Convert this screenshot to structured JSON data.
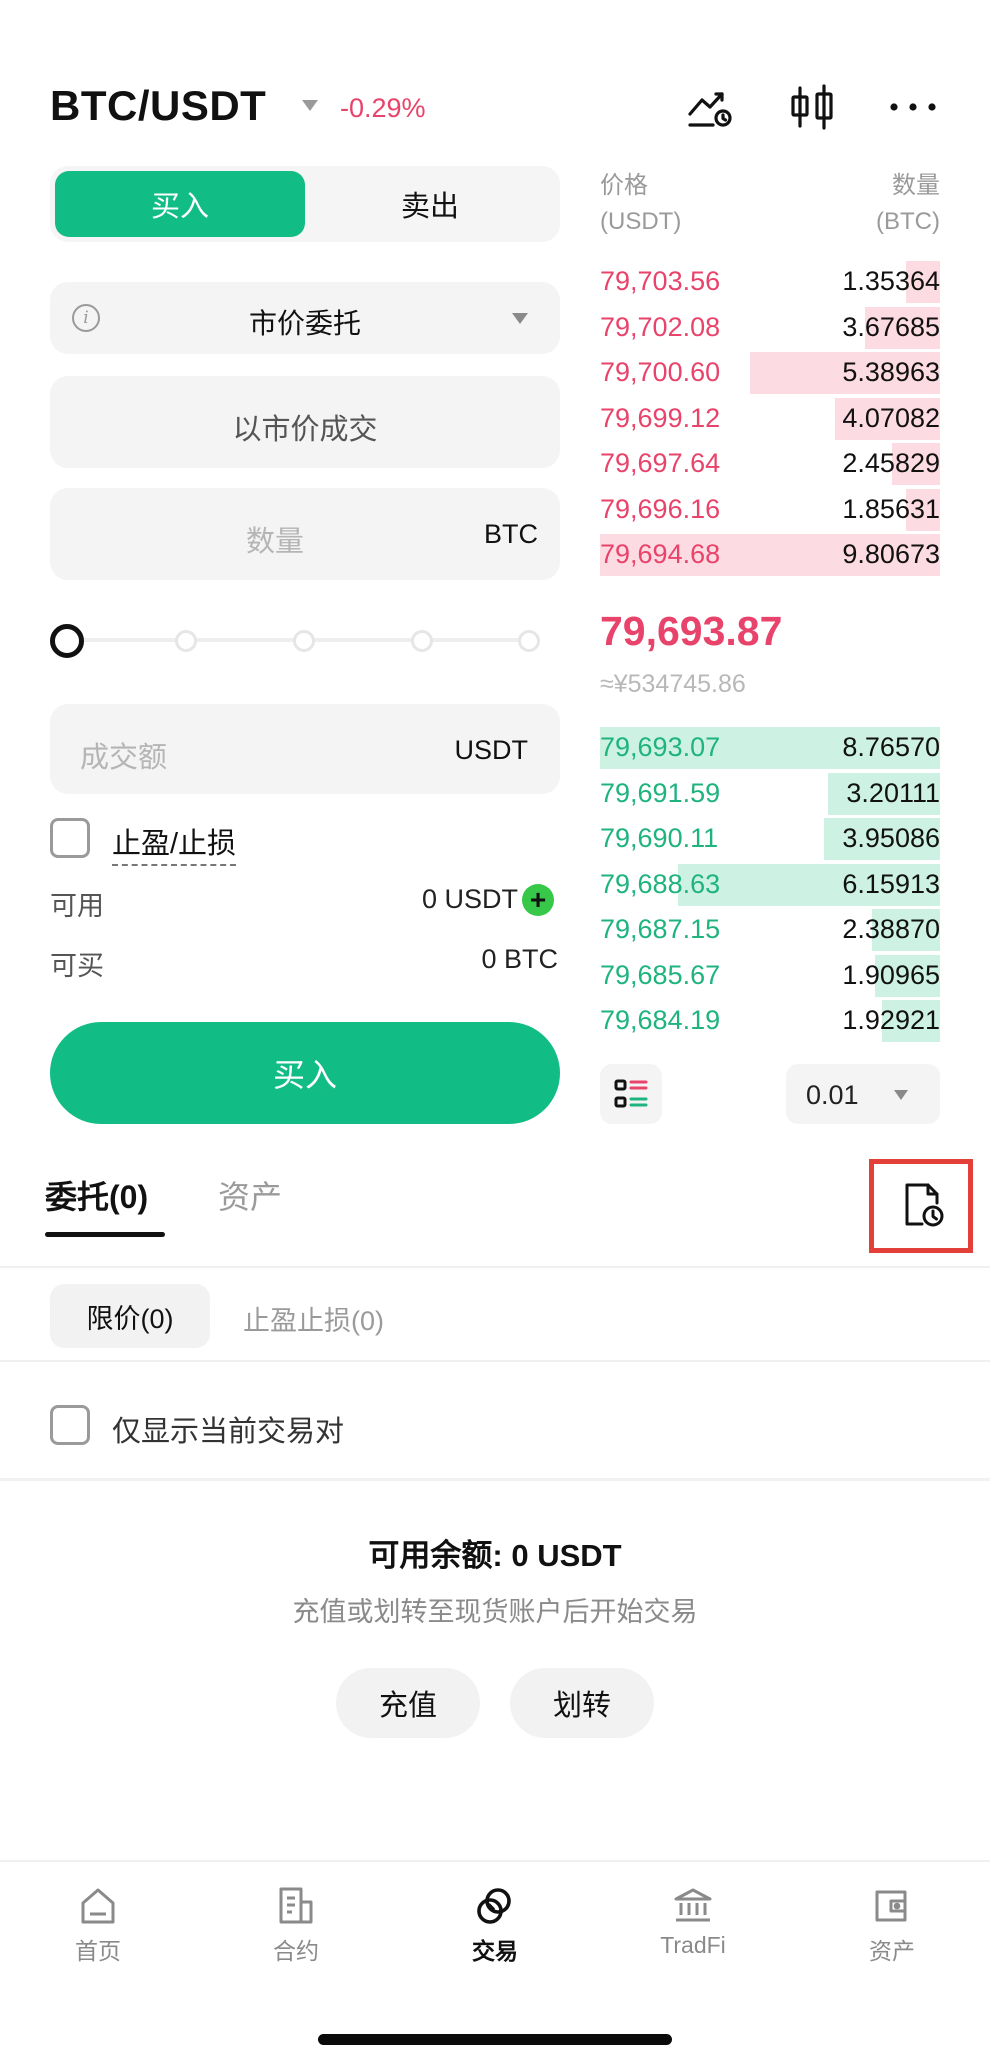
{
  "header": {
    "pair": "BTC/USDT",
    "change": "-0.29%",
    "icons": [
      "chart-alert-icon",
      "candlestick-icon",
      "more-icon"
    ]
  },
  "trade_form": {
    "buy_tab": "买入",
    "sell_tab": "卖出",
    "order_type": "市价委托",
    "market_price_text": "以市价成交",
    "quantity_placeholder": "数量",
    "quantity_unit": "BTC",
    "amount_placeholder": "成交额",
    "amount_unit": "USDT",
    "tpsl_label": "止盈/止损",
    "available_label": "可用",
    "available_value": "0 USDT",
    "can_buy_label": "可买",
    "can_buy_value": "0 BTC",
    "submit_label": "买入",
    "slider_percent": 0
  },
  "order_book": {
    "price_header": "价格",
    "price_unit": "(USDT)",
    "qty_header": "数量",
    "qty_unit": "(BTC)",
    "asks": [
      {
        "price": "79,703.56",
        "amount": "1.35364",
        "depth": 0.1
      },
      {
        "price": "79,702.08",
        "amount": "3.67685",
        "depth": 0.22
      },
      {
        "price": "79,700.60",
        "amount": "5.38963",
        "depth": 0.56
      },
      {
        "price": "79,699.12",
        "amount": "4.07082",
        "depth": 0.31
      },
      {
        "price": "79,697.64",
        "amount": "2.45829",
        "depth": 0.14
      },
      {
        "price": "79,696.16",
        "amount": "1.85631",
        "depth": 0.1
      },
      {
        "price": "79,694.68",
        "amount": "9.80673",
        "depth": 1.0
      }
    ],
    "last_price": "79,693.87",
    "last_price_cny": "≈¥534745.86",
    "bids": [
      {
        "price": "79,693.07",
        "amount": "8.76570",
        "depth": 1.0
      },
      {
        "price": "79,691.59",
        "amount": "3.20111",
        "depth": 0.33
      },
      {
        "price": "79,690.11",
        "amount": "3.95086",
        "depth": 0.34
      },
      {
        "price": "79,688.63",
        "amount": "6.15913",
        "depth": 0.77
      },
      {
        "price": "79,687.15",
        "amount": "2.38870",
        "depth": 0.2
      },
      {
        "price": "79,685.67",
        "amount": "1.90965",
        "depth": 0.19
      },
      {
        "price": "79,684.19",
        "amount": "1.92921",
        "depth": 0.17
      }
    ],
    "precision": "0.01"
  },
  "orders_panel": {
    "tab_orders": "委托(0)",
    "tab_assets": "资产",
    "sub_limit": "限价(0)",
    "sub_tpsl": "止盈止损(0)",
    "current_pair_only": "仅显示当前交易对",
    "balance_title": "可用余额: 0 USDT",
    "balance_hint": "充值或划转至现货账户后开始交易",
    "deposit_label": "充值",
    "transfer_label": "划转"
  },
  "nav": {
    "items": [
      {
        "label": "首页",
        "icon": "home-icon",
        "active": false
      },
      {
        "label": "合约",
        "icon": "contract-icon",
        "active": false
      },
      {
        "label": "交易",
        "icon": "trade-icon",
        "active": true
      },
      {
        "label": "TradFi",
        "icon": "bank-icon",
        "active": false
      },
      {
        "label": "资产",
        "icon": "wallet-icon",
        "active": false
      }
    ]
  },
  "colors": {
    "green": "#12bd85",
    "red": "#e8436a",
    "highlight_box": "#e4403a"
  }
}
